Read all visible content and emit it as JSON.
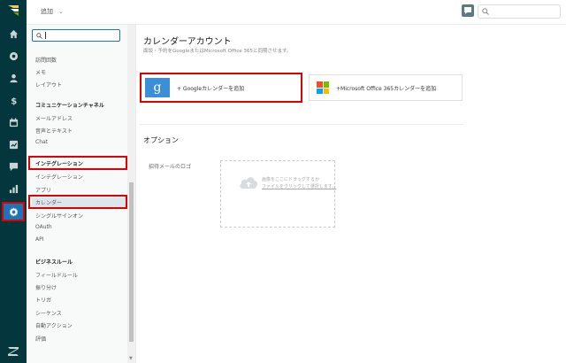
{
  "topbar": {
    "add_label": "追加",
    "chevron_icon": "chevron-down-icon",
    "search_placeholder": ""
  },
  "rail": {
    "items": [
      "home-icon",
      "views-icon",
      "customers-icon",
      "billing-icon",
      "calendar-icon",
      "reporting-icon",
      "chat-icon",
      "bar-chart-icon",
      "gear-icon"
    ],
    "active": "gear-icon"
  },
  "sidebar": {
    "search_value": "",
    "items_top": [
      "訪問回数",
      "メモ",
      "レイアウト"
    ],
    "section_comm": "コミュニケーションチャネル",
    "items_comm": [
      "メールアドレス",
      "音声とテキスト",
      "Chat"
    ],
    "section_integ": "インテグレーション",
    "items_integ": [
      "インテグレーション",
      "アプリ",
      "カレンダー",
      "シングルサインオン",
      "OAuth",
      "API"
    ],
    "section_biz": "ビジネスルール",
    "items_biz": [
      "フィールドルール",
      "振り分け",
      "トリガ",
      "シーケンス",
      "自動アクション",
      "評価"
    ]
  },
  "main": {
    "title": "カレンダーアカウント",
    "subtitle": "面談・予約をGoogleまたはMicrosoft Office 365と同期させます。",
    "google_logo": "g",
    "google_label": "+ Googleカレンダーを追加",
    "ms_label": "+Microsoft Office 365カレンダーを追加",
    "options_title": "オプション",
    "email_logo_label": "招待メールのロゴ",
    "dropzone_line1": "画像をここにドラッグするか",
    "dropzone_line2": "ファイルをクリックして選択します。"
  },
  "colors": {
    "rail_bg": "#03363d",
    "accent": "#1f73b7",
    "highlight": "#e00000",
    "google_blue": "#3b8fd9",
    "ms_red": "#f25022",
    "ms_green": "#7fba00",
    "ms_blue": "#00a4ef",
    "ms_yellow": "#ffb900"
  }
}
